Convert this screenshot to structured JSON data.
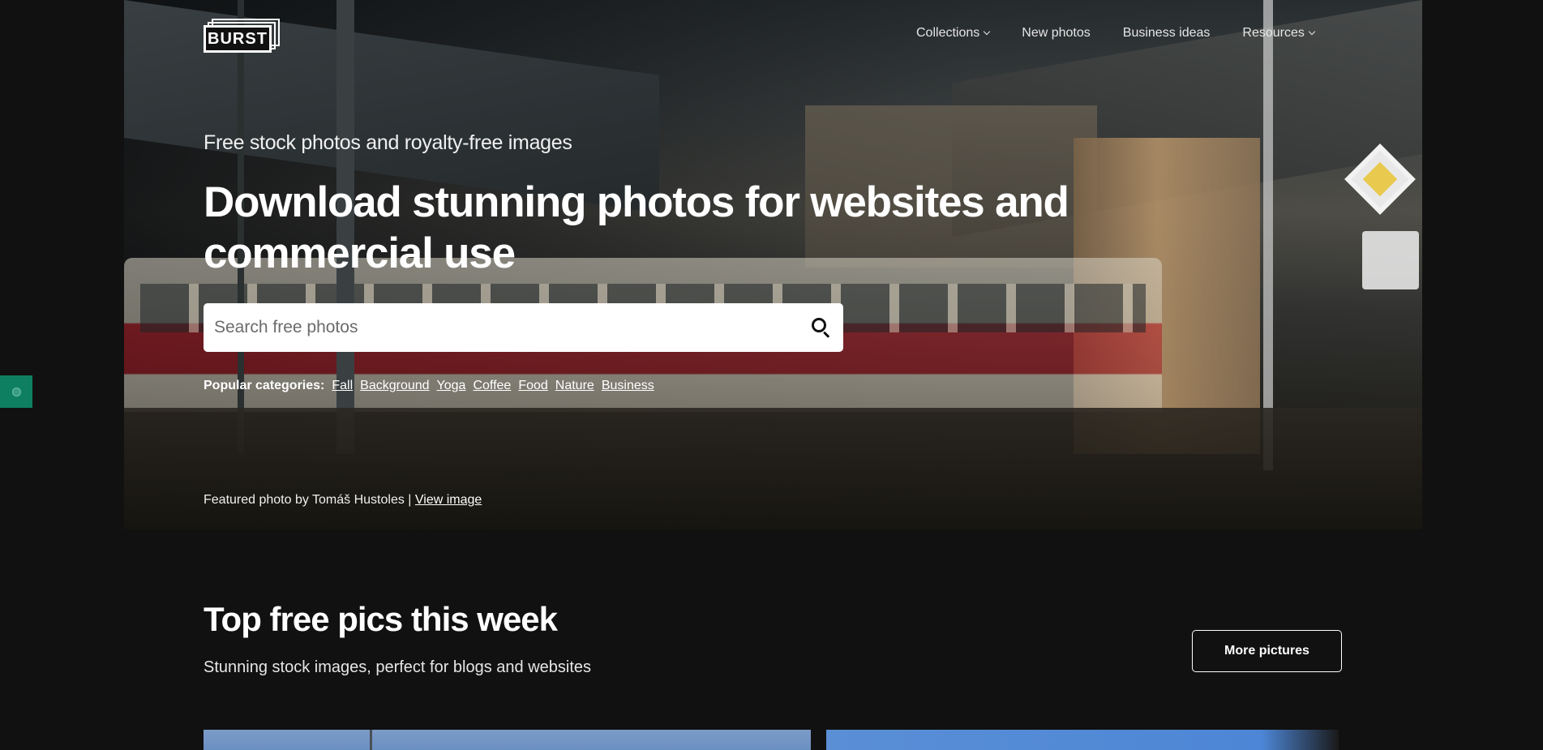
{
  "logo": {
    "text": "BURST"
  },
  "nav": {
    "items": [
      {
        "label": "Collections",
        "has_dropdown": true
      },
      {
        "label": "New photos",
        "has_dropdown": false
      },
      {
        "label": "Business ideas",
        "has_dropdown": false
      },
      {
        "label": "Resources",
        "has_dropdown": true
      }
    ]
  },
  "hero": {
    "eyebrow": "Free stock photos and royalty-free images",
    "headline": "Download stunning photos for websites and commercial use",
    "search": {
      "placeholder": "Search free photos",
      "value": ""
    },
    "categories_label": "Popular categories:",
    "categories": [
      "Fall",
      "Background",
      "Yoga",
      "Coffee",
      "Food",
      "Nature",
      "Business"
    ],
    "credit_text": "Featured photo by Tomáš Hustoles | ",
    "credit_link": "View image"
  },
  "section": {
    "title": "Top free pics this week",
    "subtitle": "Stunning stock images, perfect for blogs and websites",
    "more_button": "More pictures"
  },
  "icons": {
    "search": "search-icon",
    "dropdown": "chevron-down-icon",
    "side_tab": "info-icon"
  },
  "colors": {
    "background": "#111111",
    "text": "#ffffff",
    "side_tab": "#0f7f62"
  }
}
